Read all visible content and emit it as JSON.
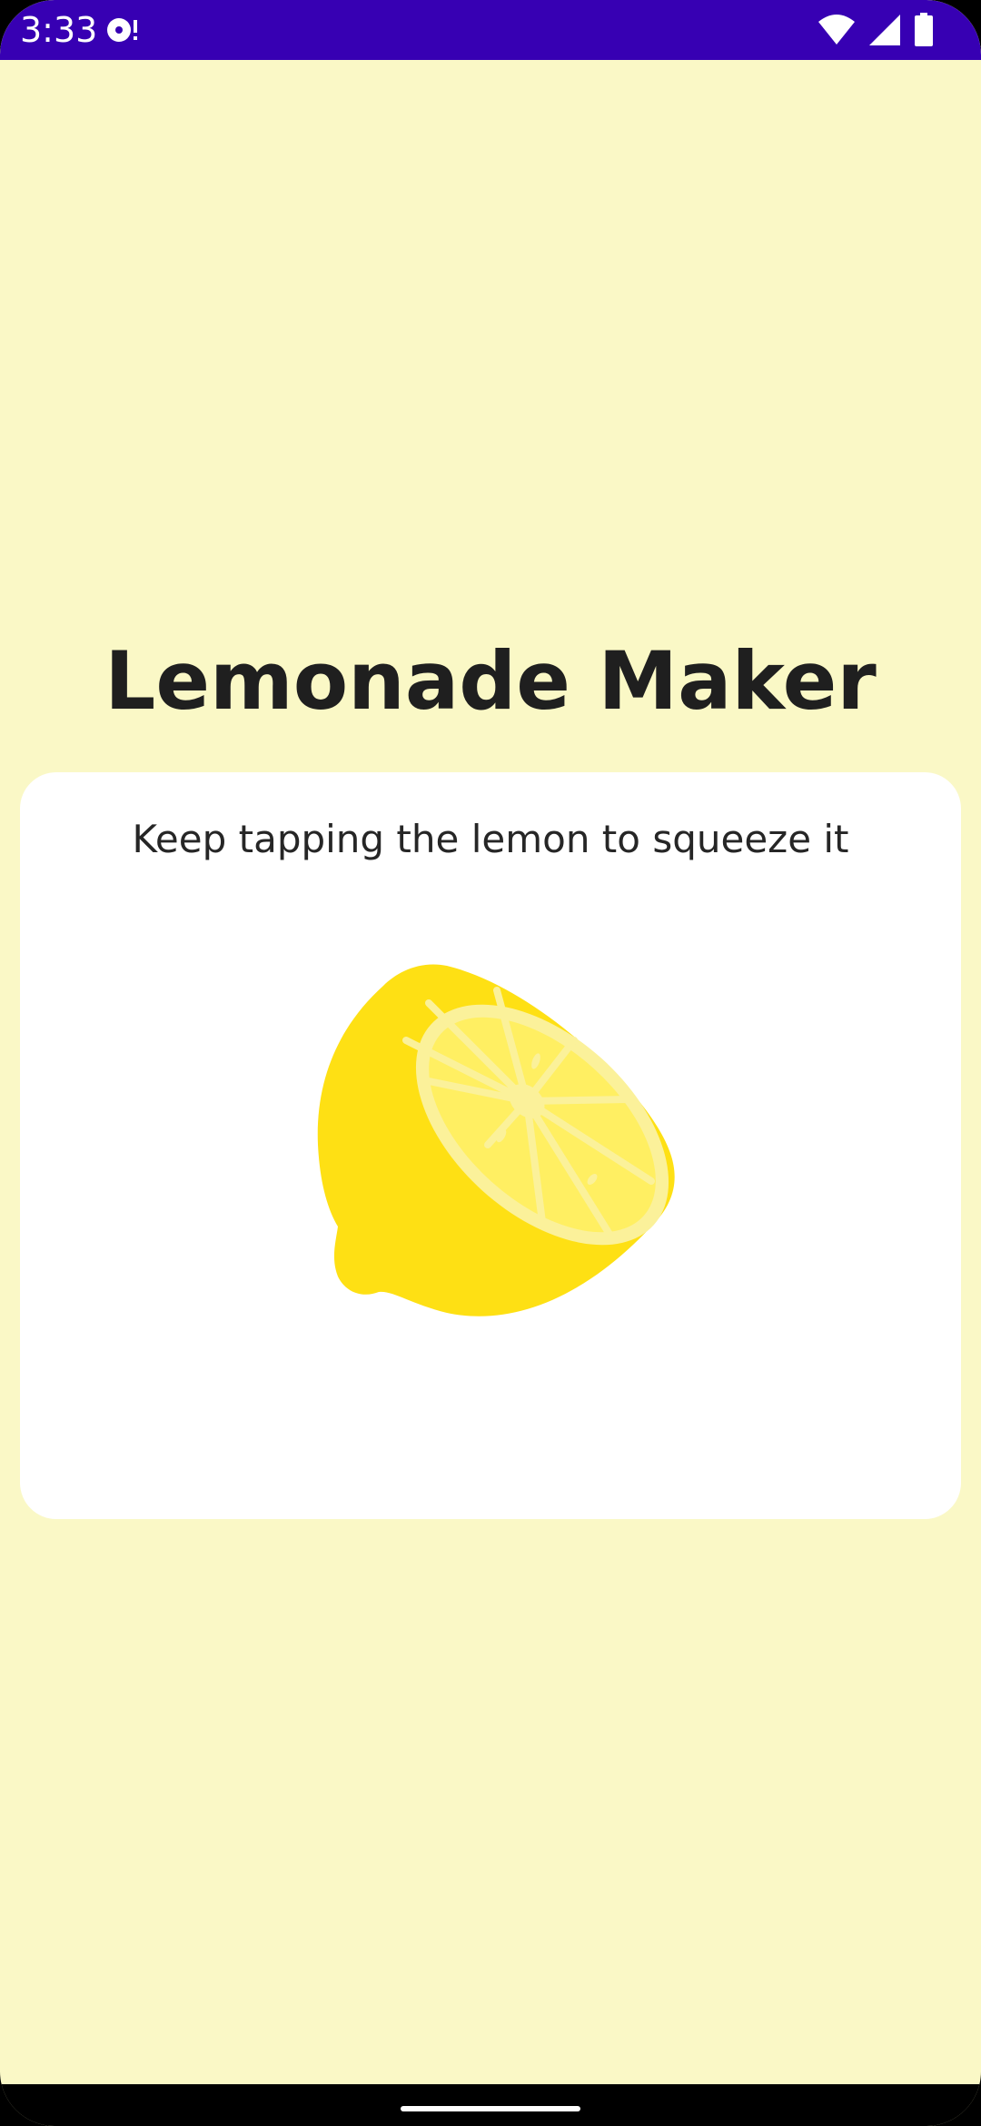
{
  "status_bar": {
    "time": "3:33",
    "notification_icon": "media-notification-icon",
    "wifi_icon": "wifi-icon",
    "signal_icon": "cellular-signal-icon",
    "battery_icon": "battery-icon",
    "background_color": "#3700B3"
  },
  "app": {
    "title": "Lemonade Maker",
    "background_color": "#FAF8C6"
  },
  "card": {
    "instruction": "Keep tapping the lemon to squeeze it",
    "image_icon": "lemon-icon",
    "lemon_color": "#FEE014"
  },
  "navigation": {
    "home_handle_icon": "gesture-handle"
  }
}
